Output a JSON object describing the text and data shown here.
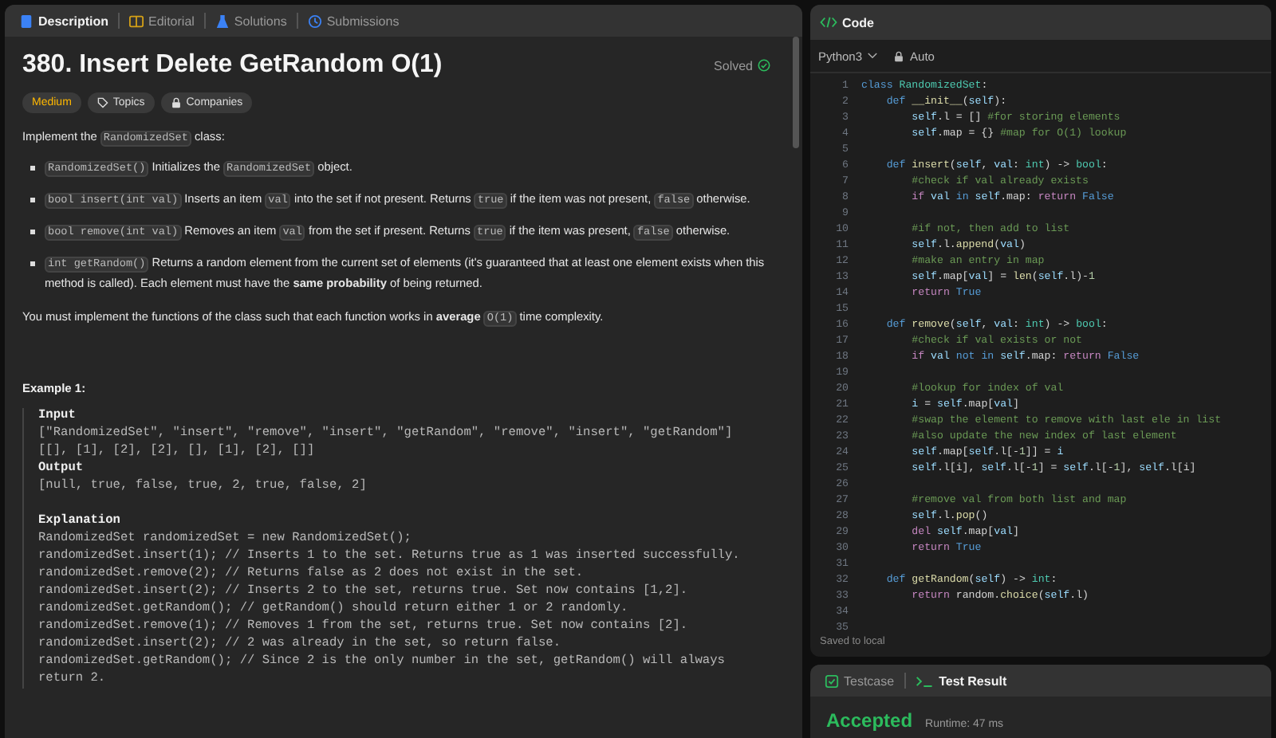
{
  "left_tabs": [
    {
      "kind": "description",
      "label": "Description",
      "selected": true
    },
    {
      "kind": "editorial",
      "label": "Editorial",
      "selected": false
    },
    {
      "kind": "solutions",
      "label": "Solutions",
      "selected": false
    },
    {
      "kind": "submissions",
      "label": "Submissions",
      "selected": false
    }
  ],
  "problem": {
    "title": "380. Insert Delete GetRandom O(1)",
    "status": "Solved",
    "tags": [
      {
        "kind": "difficulty",
        "label": "Medium"
      },
      {
        "kind": "topics",
        "label": "Topics"
      },
      {
        "kind": "companies",
        "label": "Companies"
      }
    ],
    "intro": [
      {
        "kind": "text",
        "text": "Implement the "
      },
      {
        "kind": "code",
        "text": "RandomizedSet"
      },
      {
        "kind": "text",
        "text": " class:"
      }
    ],
    "bullets": [
      [
        {
          "kind": "code",
          "text": "RandomizedSet()"
        },
        {
          "kind": "text",
          "text": " Initializes the "
        },
        {
          "kind": "code",
          "text": "RandomizedSet"
        },
        {
          "kind": "text",
          "text": " object."
        }
      ],
      [
        {
          "kind": "code",
          "text": "bool insert(int val)"
        },
        {
          "kind": "text",
          "text": " Inserts an item "
        },
        {
          "kind": "code",
          "text": "val"
        },
        {
          "kind": "text",
          "text": " into the set if not present. Returns "
        },
        {
          "kind": "code",
          "text": "true"
        },
        {
          "kind": "text",
          "text": " if the item was not present, "
        },
        {
          "kind": "code",
          "text": "false"
        },
        {
          "kind": "text",
          "text": " otherwise."
        }
      ],
      [
        {
          "kind": "code",
          "text": "bool remove(int val)"
        },
        {
          "kind": "text",
          "text": " Removes an item "
        },
        {
          "kind": "code",
          "text": "val"
        },
        {
          "kind": "text",
          "text": " from the set if present. Returns "
        },
        {
          "kind": "code",
          "text": "true"
        },
        {
          "kind": "text",
          "text": " if the item was present, "
        },
        {
          "kind": "code",
          "text": "false"
        },
        {
          "kind": "text",
          "text": " otherwise."
        }
      ],
      [
        {
          "kind": "code",
          "text": "int getRandom()"
        },
        {
          "kind": "text",
          "text": " Returns a random element from the current set of elements (it's guaranteed that at least one element exists when this method is called). Each element must have the **same probability** of being returned."
        }
      ]
    ],
    "closing": [
      {
        "kind": "text",
        "text": "You must implement the functions of the class such that each function works in **average** "
      },
      {
        "kind": "code",
        "text": "O(1)"
      },
      {
        "kind": "text",
        "text": " time complexity."
      }
    ]
  },
  "example": {
    "title": "Example 1:",
    "input_label": "Input",
    "input_lines": [
      "[\"RandomizedSet\", \"insert\", \"remove\", \"insert\", \"getRandom\", \"remove\", \"insert\", \"getRandom\"]",
      "[[], [1], [2], [2], [], [1], [2], []]"
    ],
    "output_label": "Output",
    "output_lines": [
      "[null, true, false, true, 2, true, false, 2]"
    ],
    "explanation_label": "Explanation",
    "explanation_lines": [
      "RandomizedSet randomizedSet = new RandomizedSet();",
      "randomizedSet.insert(1); // Inserts 1 to the set. Returns true as 1 was inserted successfully.",
      "randomizedSet.remove(2); // Returns false as 2 does not exist in the set.",
      "randomizedSet.insert(2); // Inserts 2 to the set, returns true. Set now contains [1,2].",
      "randomizedSet.getRandom(); // getRandom() should return either 1 or 2 randomly.",
      "randomizedSet.remove(1); // Removes 1 from the set, returns true. Set now contains [2].",
      "randomizedSet.insert(2); // 2 was already in the set, so return false.",
      "randomizedSet.getRandom(); // Since 2 is the only number in the set, getRandom() will always return 2."
    ]
  },
  "editor": {
    "title": "Code",
    "language": "Python3",
    "autosave": "Auto",
    "status": "Saved to local",
    "lines": [
      {
        "number": "1",
        "code": [
          {
            "kind": "k",
            "text": "class "
          },
          {
            "kind": "c",
            "text": "RandomizedSet"
          },
          {
            "kind": "p",
            "text": ":"
          }
        ]
      },
      {
        "number": "2",
        "code": [
          {
            "kind": "k",
            "text": "    def "
          },
          {
            "kind": "f",
            "text": "__init__"
          },
          {
            "kind": "p",
            "text": "("
          },
          {
            "kind": "v",
            "text": "self"
          },
          {
            "kind": "p",
            "text": "):"
          }
        ]
      },
      {
        "number": "3",
        "code": [
          {
            "kind": "v",
            "text": "        self"
          },
          {
            "kind": "p",
            "text": ".l = [] "
          },
          {
            "kind": "m",
            "text": "#for storing elements"
          }
        ]
      },
      {
        "number": "4",
        "code": [
          {
            "kind": "v",
            "text": "        self"
          },
          {
            "kind": "p",
            "text": ".map = {} "
          },
          {
            "kind": "m",
            "text": "#map for O(1) lookup"
          }
        ]
      },
      {
        "number": "5"
      },
      {
        "number": "6",
        "code": [
          {
            "kind": "k",
            "text": "    def "
          },
          {
            "kind": "f",
            "text": "insert"
          },
          {
            "kind": "p",
            "text": "("
          },
          {
            "kind": "v",
            "text": "self"
          },
          {
            "kind": "p",
            "text": ", "
          },
          {
            "kind": "v",
            "text": "val"
          },
          {
            "kind": "p",
            "text": ": "
          },
          {
            "kind": "c",
            "text": "int"
          },
          {
            "kind": "p",
            "text": ") -> "
          },
          {
            "kind": "c",
            "text": "bool"
          },
          {
            "kind": "p",
            "text": ":"
          }
        ]
      },
      {
        "number": "7",
        "code": [
          {
            "kind": "m",
            "text": "        #check if val already exists"
          }
        ]
      },
      {
        "number": "8",
        "code": [
          {
            "kind": "r",
            "text": "        if "
          },
          {
            "kind": "v",
            "text": "val"
          },
          {
            "kind": "k",
            "text": " in "
          },
          {
            "kind": "v",
            "text": "self"
          },
          {
            "kind": "p",
            "text": ".map: "
          },
          {
            "kind": "r",
            "text": "return "
          },
          {
            "kind": "k",
            "text": "False"
          }
        ]
      },
      {
        "number": "9"
      },
      {
        "number": "10",
        "code": [
          {
            "kind": "m",
            "text": "        #if not, then add to list"
          }
        ]
      },
      {
        "number": "11",
        "code": [
          {
            "kind": "v",
            "text": "        self"
          },
          {
            "kind": "p",
            "text": ".l."
          },
          {
            "kind": "f",
            "text": "append"
          },
          {
            "kind": "p",
            "text": "("
          },
          {
            "kind": "v",
            "text": "val"
          },
          {
            "kind": "p",
            "text": ")"
          }
        ]
      },
      {
        "number": "12",
        "code": [
          {
            "kind": "m",
            "text": "        #make an entry in map"
          }
        ]
      },
      {
        "number": "13",
        "code": [
          {
            "kind": "v",
            "text": "        self"
          },
          {
            "kind": "p",
            "text": ".map["
          },
          {
            "kind": "v",
            "text": "val"
          },
          {
            "kind": "p",
            "text": "] = "
          },
          {
            "kind": "f",
            "text": "len"
          },
          {
            "kind": "p",
            "text": "("
          },
          {
            "kind": "v",
            "text": "self"
          },
          {
            "kind": "p",
            "text": ".l)-"
          },
          {
            "kind": "n",
            "text": "1"
          }
        ]
      },
      {
        "number": "14",
        "code": [
          {
            "kind": "r",
            "text": "        return "
          },
          {
            "kind": "k",
            "text": "True"
          }
        ]
      },
      {
        "number": "15"
      },
      {
        "number": "16",
        "code": [
          {
            "kind": "k",
            "text": "    def "
          },
          {
            "kind": "f",
            "text": "remove"
          },
          {
            "kind": "p",
            "text": "("
          },
          {
            "kind": "v",
            "text": "self"
          },
          {
            "kind": "p",
            "text": ", "
          },
          {
            "kind": "v",
            "text": "val"
          },
          {
            "kind": "p",
            "text": ": "
          },
          {
            "kind": "c",
            "text": "int"
          },
          {
            "kind": "p",
            "text": ") -> "
          },
          {
            "kind": "c",
            "text": "bool"
          },
          {
            "kind": "p",
            "text": ":"
          }
        ]
      },
      {
        "number": "17",
        "code": [
          {
            "kind": "m",
            "text": "        #check if val exists or not"
          }
        ]
      },
      {
        "number": "18",
        "code": [
          {
            "kind": "r",
            "text": "        if "
          },
          {
            "kind": "v",
            "text": "val"
          },
          {
            "kind": "k",
            "text": " not in "
          },
          {
            "kind": "v",
            "text": "self"
          },
          {
            "kind": "p",
            "text": ".map: "
          },
          {
            "kind": "r",
            "text": "return "
          },
          {
            "kind": "k",
            "text": "False"
          }
        ]
      },
      {
        "number": "19"
      },
      {
        "number": "20",
        "code": [
          {
            "kind": "m",
            "text": "        #lookup for index of val"
          }
        ]
      },
      {
        "number": "21",
        "code": [
          {
            "kind": "v",
            "text": "        i"
          },
          {
            "kind": "p",
            "text": " = "
          },
          {
            "kind": "v",
            "text": "self"
          },
          {
            "kind": "p",
            "text": ".map["
          },
          {
            "kind": "v",
            "text": "val"
          },
          {
            "kind": "p",
            "text": "]"
          }
        ]
      },
      {
        "number": "22",
        "code": [
          {
            "kind": "m",
            "text": "        #swap the element to remove with last ele in list"
          }
        ]
      },
      {
        "number": "23",
        "code": [
          {
            "kind": "m",
            "text": "        #also update the new index of last element"
          }
        ]
      },
      {
        "number": "24",
        "code": [
          {
            "kind": "v",
            "text": "        self"
          },
          {
            "kind": "p",
            "text": ".map["
          },
          {
            "kind": "v",
            "text": "self"
          },
          {
            "kind": "p",
            "text": ".l[-"
          },
          {
            "kind": "n",
            "text": "1"
          },
          {
            "kind": "p",
            "text": "]] = "
          },
          {
            "kind": "v",
            "text": "i"
          }
        ]
      },
      {
        "number": "25",
        "code": [
          {
            "kind": "v",
            "text": "        self"
          },
          {
            "kind": "p",
            "text": ".l[i], "
          },
          {
            "kind": "v",
            "text": "self"
          },
          {
            "kind": "p",
            "text": ".l[-"
          },
          {
            "kind": "n",
            "text": "1"
          },
          {
            "kind": "p",
            "text": "] = "
          },
          {
            "kind": "v",
            "text": "self"
          },
          {
            "kind": "p",
            "text": ".l[-"
          },
          {
            "kind": "n",
            "text": "1"
          },
          {
            "kind": "p",
            "text": "], "
          },
          {
            "kind": "v",
            "text": "self"
          },
          {
            "kind": "p",
            "text": ".l[i]"
          }
        ]
      },
      {
        "number": "26"
      },
      {
        "number": "27",
        "code": [
          {
            "kind": "m",
            "text": "        #remove val from both list and map"
          }
        ]
      },
      {
        "number": "28",
        "code": [
          {
            "kind": "v",
            "text": "        self"
          },
          {
            "kind": "p",
            "text": ".l."
          },
          {
            "kind": "f",
            "text": "pop"
          },
          {
            "kind": "p",
            "text": "()"
          }
        ]
      },
      {
        "number": "29",
        "code": [
          {
            "kind": "r",
            "text": "        del "
          },
          {
            "kind": "v",
            "text": "self"
          },
          {
            "kind": "p",
            "text": ".map["
          },
          {
            "kind": "v",
            "text": "val"
          },
          {
            "kind": "p",
            "text": "]"
          }
        ]
      },
      {
        "number": "30",
        "code": [
          {
            "kind": "r",
            "text": "        return "
          },
          {
            "kind": "k",
            "text": "True"
          }
        ]
      },
      {
        "number": "31"
      },
      {
        "number": "32",
        "code": [
          {
            "kind": "k",
            "text": "    def "
          },
          {
            "kind": "f",
            "text": "getRandom"
          },
          {
            "kind": "p",
            "text": "("
          },
          {
            "kind": "v",
            "text": "self"
          },
          {
            "kind": "p",
            "text": ") -> "
          },
          {
            "kind": "c",
            "text": "int"
          },
          {
            "kind": "p",
            "text": ":"
          }
        ]
      },
      {
        "number": "33",
        "code": [
          {
            "kind": "r",
            "text": "        return "
          },
          {
            "kind": "p",
            "text": "random."
          },
          {
            "kind": "f",
            "text": "choice"
          },
          {
            "kind": "p",
            "text": "("
          },
          {
            "kind": "v",
            "text": "self"
          },
          {
            "kind": "p",
            "text": ".l)"
          }
        ]
      },
      {
        "number": "34"
      },
      {
        "number": "35"
      }
    ]
  },
  "result": {
    "tabs": [
      {
        "kind": "testcase",
        "label": "Testcase",
        "selected": false
      },
      {
        "kind": "result",
        "label": "Test Result",
        "selected": true
      }
    ],
    "verdict": "Accepted",
    "runtime": "Runtime: 47 ms"
  }
}
